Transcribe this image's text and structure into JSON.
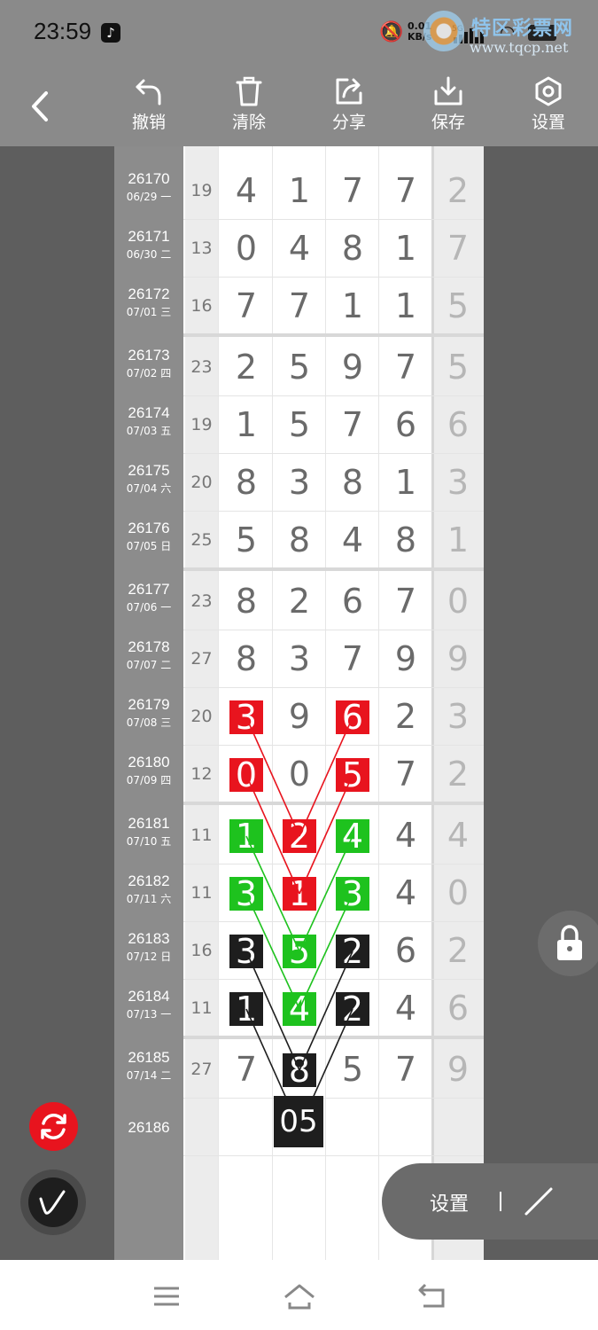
{
  "status_bar": {
    "time": "23:59",
    "speed_top": "0.01",
    "speed_bottom": "KB/s",
    "network": "5G"
  },
  "watermark": {
    "text": "特区彩票网",
    "url": "www.tqcp.net"
  },
  "toolbar": {
    "undo": "撤销",
    "clear": "清除",
    "share": "分享",
    "save": "保存",
    "settings": "设置"
  },
  "rows": [
    {
      "issue": "26170",
      "date": "06/29 一",
      "sum": "19",
      "digits": [
        "4",
        "1",
        "7",
        "7"
      ],
      "last": "2"
    },
    {
      "issue": "26171",
      "date": "06/30 二",
      "sum": "13",
      "digits": [
        "0",
        "4",
        "8",
        "1"
      ],
      "last": "7"
    },
    {
      "issue": "26172",
      "date": "07/01 三",
      "sum": "16",
      "digits": [
        "7",
        "7",
        "1",
        "1"
      ],
      "last": "5"
    },
    {
      "issue": "26173",
      "date": "07/02 四",
      "sum": "23",
      "digits": [
        "2",
        "5",
        "9",
        "7"
      ],
      "last": "5"
    },
    {
      "issue": "26174",
      "date": "07/03 五",
      "sum": "19",
      "digits": [
        "1",
        "5",
        "7",
        "6"
      ],
      "last": "6"
    },
    {
      "issue": "26175",
      "date": "07/04 六",
      "sum": "20",
      "digits": [
        "8",
        "3",
        "8",
        "1"
      ],
      "last": "3"
    },
    {
      "issue": "26176",
      "date": "07/05 日",
      "sum": "25",
      "digits": [
        "5",
        "8",
        "4",
        "8"
      ],
      "last": "1"
    },
    {
      "issue": "26177",
      "date": "07/06 一",
      "sum": "23",
      "digits": [
        "8",
        "2",
        "6",
        "7"
      ],
      "last": "0"
    },
    {
      "issue": "26178",
      "date": "07/07 二",
      "sum": "27",
      "digits": [
        "8",
        "3",
        "7",
        "9"
      ],
      "last": "9"
    },
    {
      "issue": "26179",
      "date": "07/08 三",
      "sum": "20",
      "digits": [
        "3",
        "9",
        "6",
        "2"
      ],
      "last": "3"
    },
    {
      "issue": "26180",
      "date": "07/09 四",
      "sum": "12",
      "digits": [
        "0",
        "0",
        "5",
        "7"
      ],
      "last": "2"
    },
    {
      "issue": "26181",
      "date": "07/10 五",
      "sum": "11",
      "digits": [
        "1",
        "2",
        "4",
        "4"
      ],
      "last": "4"
    },
    {
      "issue": "26182",
      "date": "07/11 六",
      "sum": "11",
      "digits": [
        "3",
        "1",
        "3",
        "4"
      ],
      "last": "0"
    },
    {
      "issue": "26183",
      "date": "07/12 日",
      "sum": "16",
      "digits": [
        "3",
        "5",
        "2",
        "6"
      ],
      "last": "2"
    },
    {
      "issue": "26184",
      "date": "07/13 一",
      "sum": "11",
      "digits": [
        "1",
        "4",
        "2",
        "4"
      ],
      "last": "6"
    },
    {
      "issue": "26185",
      "date": "07/14 二",
      "sum": "27",
      "digits": [
        "7",
        "8",
        "5",
        "7"
      ],
      "last": "9"
    },
    {
      "issue": "26186",
      "date": "",
      "sum": "",
      "digits": [
        "",
        "",
        "",
        ""
      ],
      "last": ""
    }
  ],
  "prediction": "05",
  "highlight_colors": {
    "red": "#e8141e",
    "green": "#1ec21e",
    "black": "#1e1e1e"
  },
  "floating": {
    "pill_label": "设置",
    "lock_icon": "lock-icon",
    "refresh_icon": "refresh-icon",
    "pen_icon": "signature-pen-icon"
  }
}
